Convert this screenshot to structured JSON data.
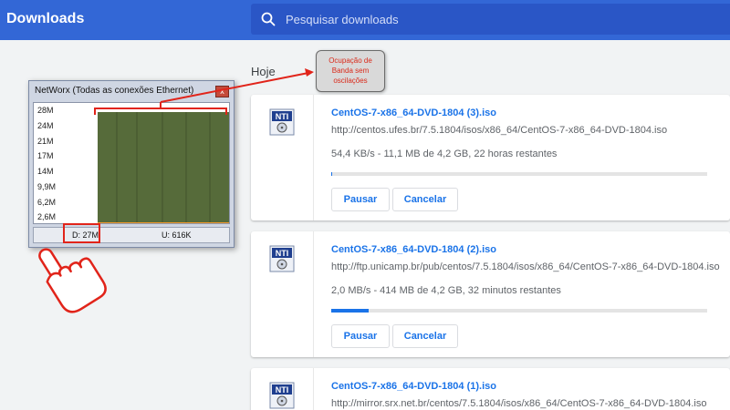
{
  "header": {
    "title": "Downloads",
    "search_placeholder": "Pesquisar downloads",
    "accent_color": "#3367d6"
  },
  "section": {
    "label": "Hoje"
  },
  "downloads": [
    {
      "filename": "CentOS-7-x86_64-DVD-1804 (3).iso",
      "url": "http://centos.ufes.br/7.5.1804/isos/x86_64/CentOS-7-x86_64-DVD-1804.iso",
      "status": "54,4 KB/s - 11,1 MB de 4,2 GB, 22 horas restantes",
      "progress": 0.003,
      "pause_label": "Pausar",
      "cancel_label": "Cancelar",
      "icon": "nti-file-icon"
    },
    {
      "filename": "CentOS-7-x86_64-DVD-1804 (2).iso",
      "url": "http://ftp.unicamp.br/pub/centos/7.5.1804/isos/x86_64/CentOS-7-x86_64-DVD-1804.iso",
      "status": "2,0 MB/s - 414 MB de 4,2 GB, 32 minutos restantes",
      "progress": 0.1,
      "pause_label": "Pausar",
      "cancel_label": "Cancelar",
      "icon": "nti-file-icon"
    },
    {
      "filename": "CentOS-7-x86_64-DVD-1804 (1).iso",
      "url": "http://mirror.srx.net.br/centos/7.5.1804/isos/x86_64/CentOS-7-x86_64-DVD-1804.iso",
      "icon": "nti-file-icon"
    }
  ],
  "networx": {
    "title": "NetWorx (Todas as conexões Ethernet)",
    "close_label": "x",
    "y_labels": [
      "28M",
      "24M",
      "21M",
      "17M",
      "14M",
      "9,9M",
      "6,2M",
      "2,6M"
    ],
    "download": "D: 27M",
    "upload": "U: 616K",
    "download_color": "#566b3a",
    "upload_color": "#f29a2e"
  },
  "annotation": {
    "callout_lines": [
      "Ocupação de",
      "Banda sem",
      "oscilações"
    ],
    "color": "#e1241a"
  }
}
